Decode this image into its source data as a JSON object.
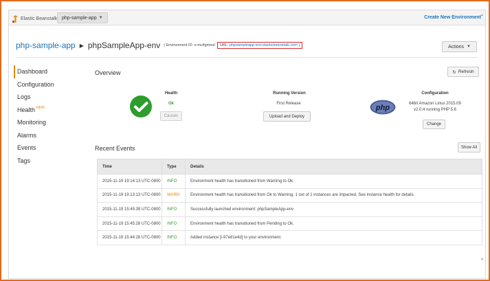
{
  "topbar": {
    "brand": "Elastic Beanstalk",
    "app_dropdown": "php-sample-app",
    "create_new": "Create New Environment"
  },
  "breadcrumb": {
    "app": "php-sample-app",
    "env": "phpSampleApp-env",
    "env_id_label": "( Environment ID: e-mcifgmeut",
    "url_label": "URL:",
    "url": "phpsampleapp-env.elasticbeanstalk.com",
    "url_close": ")"
  },
  "actions_button": "Actions",
  "nav": {
    "items": [
      {
        "label": "Dashboard",
        "active": true
      },
      {
        "label": "Configuration"
      },
      {
        "label": "Logs"
      },
      {
        "label": "Health",
        "badge": "NEW"
      },
      {
        "label": "Monitoring"
      },
      {
        "label": "Alarms"
      },
      {
        "label": "Events"
      },
      {
        "label": "Tags"
      }
    ]
  },
  "overview": {
    "title": "Overview",
    "refresh": "Refresh",
    "health": {
      "header": "Health",
      "status": "Ok",
      "causes": "Causes"
    },
    "running_version": {
      "header": "Running Version",
      "version": "First Release",
      "upload": "Upload and Deploy"
    },
    "configuration": {
      "header": "Configuration",
      "line1": "64bit Amazon Linux 2015.09",
      "line2": "v2.0.4 running PHP 5.6",
      "change": "Change",
      "logo_text": "php"
    }
  },
  "recent_events": {
    "title": "Recent Events",
    "show_all": "Show All",
    "columns": [
      "Time",
      "Type",
      "Details"
    ],
    "rows": [
      {
        "time": "2015-11-19 19:14:13 UTC-0800",
        "type": "INFO",
        "details": "Environment health has transitioned from Warning to Ok."
      },
      {
        "time": "2015-11-19 19:13:13 UTC-0800",
        "type": "WARN",
        "details": "Environment health has transitioned from Ok to Warning. 1 out of 1 instances are impacted. See instance health for details."
      },
      {
        "time": "2015-11-19 15:45:39 UTC-0800",
        "type": "INFO",
        "details": "Successfully launched environment: phpSampleApp-env"
      },
      {
        "time": "2015-11-19 15:45:28 UTC-0800",
        "type": "INFO",
        "details": "Environment health has transitioned from Pending to Ok."
      },
      {
        "time": "2015-11-19 15:44:28 UTC-0800",
        "type": "INFO",
        "details": "Added instance [i-97e81e4d] to your environment."
      }
    ]
  },
  "colors": {
    "accent_blue": "#1a73ba",
    "ok_green": "#2e9d2e",
    "warn_orange": "#e6860f",
    "url_highlight": "#d9262b",
    "frame_orange": "#e26a1b"
  },
  "icons": {
    "brand": "elastic-beanstalk-icon",
    "health": "check-circle-icon",
    "refresh": "refresh-icon",
    "dropdown": "chevron-down-icon"
  }
}
